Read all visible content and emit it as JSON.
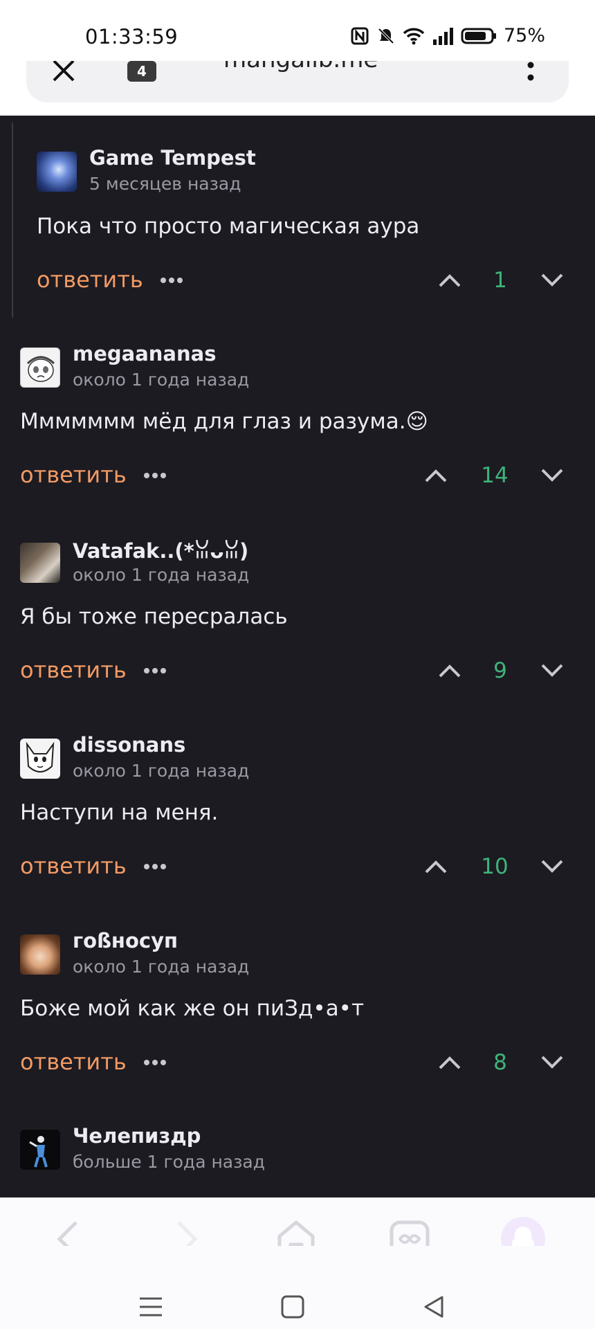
{
  "status_bar": {
    "time": "01:33:59",
    "battery": "75%"
  },
  "url_bar": {
    "tab_count": "4",
    "url": "mangalib.me"
  },
  "comment_actions": {
    "reply_label": "ответить"
  },
  "comments": [
    {
      "username": "Game Tempest",
      "timestamp": "5 месяцев назад",
      "text": "Пока что просто магическая аура",
      "score": "1",
      "nested": true
    },
    {
      "username": "megaananas",
      "timestamp": "около 1 года назад",
      "text": "Ммммммм мёд для глаз и разума.😌",
      "score": "14"
    },
    {
      "username": "Vatafak..(*ꈍᴗꈍ)",
      "timestamp": "около 1 года назад",
      "text": "Я бы тоже пересралась",
      "score": "9"
    },
    {
      "username": "dissonans",
      "timestamp": "около 1 года назад",
      "text": "Наступи на меня.",
      "score": "10"
    },
    {
      "username": "гoßносуп",
      "timestamp": "около 1 года назад",
      "text": "Боже мой как же он пиЗд•а•т",
      "score": "8"
    },
    {
      "username": "Челепиздр",
      "timestamp": "больше 1 года назад"
    }
  ],
  "colors": {
    "background": "#1c1b22",
    "reply": "#f29a63",
    "score": "#3fb37a",
    "text": "#ececf1",
    "muted": "#9b9aa3"
  },
  "icons": {
    "browser_nav": [
      "back-icon",
      "forward-icon",
      "home-icon",
      "tabs-icon",
      "assistant-icon"
    ],
    "system_nav": [
      "menu-icon",
      "home-square-icon",
      "back-triangle-icon"
    ]
  }
}
